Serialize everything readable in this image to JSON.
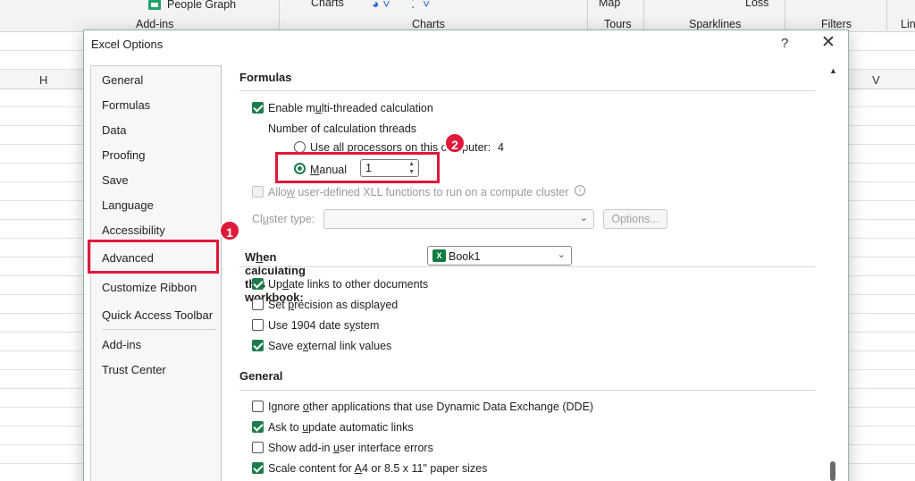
{
  "ribbon": {
    "people_graph": "People Graph",
    "addins_group": "Add-ins",
    "charts_label_top": "Charts",
    "charts_group": "Charts",
    "map_label": "Map",
    "tours_group": "Tours",
    "sparklines_group": "Sparklines",
    "loss_label": "Loss",
    "filters_group": "Filters",
    "lin_group": "Lin"
  },
  "columns": {
    "h": "H",
    "v": "V"
  },
  "dialog": {
    "title": "Excel Options",
    "help": "?",
    "close": "✕"
  },
  "nav": {
    "items": [
      "General",
      "Formulas",
      "Data",
      "Proofing",
      "Save",
      "Language",
      "Accessibility",
      "Advanced",
      "Customize Ribbon",
      "Quick Access Toolbar",
      "Add-ins",
      "Trust Center"
    ],
    "selected": "Advanced"
  },
  "formulas": {
    "title": "Formulas",
    "multithread_pre": "Enable m",
    "multithread_u": "u",
    "multithread_post": "lti-threaded calculation",
    "threads_label": "Number of calculation threads",
    "all_pre": "",
    "all_u": "U",
    "all_post": "se all processors on this computer:",
    "all_count": "4",
    "manual_pre": "",
    "manual_u": "M",
    "manual_post": "anual",
    "manual_value": "1",
    "xll_pre": "Allo",
    "xll_u": "w",
    "xll_post": " user-defined XLL functions to run on a compute cluster",
    "cluster_pre": "Cl",
    "cluster_u": "u",
    "cluster_post": "ster type:",
    "options_btn": "Options..."
  },
  "workbook": {
    "title_pre": "W",
    "title_u": "h",
    "title_post": "en calculating this workbook:",
    "book": "Book1",
    "opt1_pre": "Up",
    "opt1_u": "d",
    "opt1_post": "ate links to other documents",
    "opt2_pre": "Set ",
    "opt2_u": "p",
    "opt2_post": "recision as displayed",
    "opt3_pre": "Use 1904 date s",
    "opt3_u": "y",
    "opt3_post": "stem",
    "opt4_pre": "Save e",
    "opt4_u": "x",
    "opt4_post": "ternal link values"
  },
  "general": {
    "title": "General",
    "opt1_pre": "Ignore ",
    "opt1_u": "o",
    "opt1_post": "ther applications that use Dynamic Data Exchange (DDE)",
    "opt2_pre": "Ask to ",
    "opt2_u": "u",
    "opt2_post": "pdate automatic links",
    "opt3_pre": "Show add-in ",
    "opt3_u": "u",
    "opt3_post": "ser interface errors",
    "opt4_pre": "Scale content for ",
    "opt4_u": "A",
    "opt4_post": "4 or 8.5 x 11\" paper sizes"
  },
  "annotations": {
    "badge1": "1",
    "badge2": "2"
  },
  "colors": {
    "accent": "#1e7c4c",
    "highlight": "#e0183a"
  }
}
